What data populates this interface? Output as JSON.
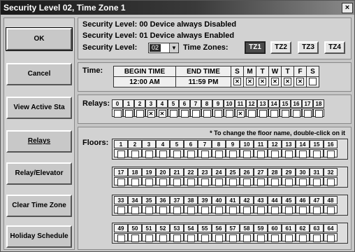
{
  "title": "Security Level 02, Time Zone 1",
  "close_glyph": "×",
  "buttons": [
    {
      "label": "OK",
      "name": "ok-button"
    },
    {
      "label": "Cancel",
      "name": "cancel-button"
    },
    {
      "label": "View Active Sta",
      "name": "view-active-status-button"
    },
    {
      "label": "Relays",
      "name": "relays-button"
    },
    {
      "label": "Relay/Elevator",
      "name": "relay-elevator-button"
    },
    {
      "label": "Clear Time Zone",
      "name": "clear-time-zone-button"
    },
    {
      "label": "Holiday Schedule",
      "name": "holiday-schedule-button"
    }
  ],
  "security": {
    "line1": "Security Level:  00 Device always Disabled",
    "line2": "Security Level:  01 Device always Enabled",
    "line3_label": "Security Level:",
    "selected_value": "02",
    "time_zones_label": "Time Zones:",
    "time_zones": [
      "TZ1",
      "TZ2",
      "TZ3",
      "TZ4"
    ],
    "active_time_zone": 0
  },
  "time": {
    "label": "Time:",
    "begin_header": "BEGIN TIME",
    "end_header": "END TIME",
    "begin_value": "12:00 AM",
    "end_value": "11:59 PM",
    "days": [
      "S",
      "M",
      "T",
      "W",
      "T",
      "F",
      "S"
    ],
    "days_checked": [
      true,
      true,
      true,
      true,
      true,
      true,
      false
    ]
  },
  "relays": {
    "label": "Relays:",
    "numbers": [
      "0",
      "1",
      "2",
      "3",
      "4",
      "5",
      "6",
      "7",
      "8",
      "9",
      "10",
      "11",
      "12",
      "13",
      "14",
      "15",
      "16",
      "17",
      "18"
    ],
    "checked": [
      false,
      false,
      false,
      true,
      true,
      false,
      false,
      false,
      false,
      false,
      false,
      true,
      false,
      false,
      false,
      false,
      false,
      false,
      false
    ]
  },
  "floors": {
    "label": "Floors:",
    "note": "* To change the floor name, double-click on it",
    "groups": [
      [
        "1",
        "2",
        "3",
        "4",
        "5",
        "6",
        "7",
        "8",
        "9",
        "10",
        "11",
        "12",
        "13",
        "14",
        "15",
        "16"
      ],
      [
        "17",
        "18",
        "19",
        "20",
        "21",
        "22",
        "23",
        "24",
        "25",
        "26",
        "27",
        "28",
        "29",
        "30",
        "31",
        "32"
      ],
      [
        "33",
        "34",
        "35",
        "36",
        "37",
        "38",
        "39",
        "40",
        "41",
        "42",
        "43",
        "44",
        "45",
        "46",
        "47",
        "48"
      ],
      [
        "49",
        "50",
        "51",
        "52",
        "53",
        "54",
        "55",
        "56",
        "57",
        "58",
        "59",
        "60",
        "61",
        "62",
        "63",
        "64"
      ]
    ]
  },
  "check_glyph": "✕"
}
